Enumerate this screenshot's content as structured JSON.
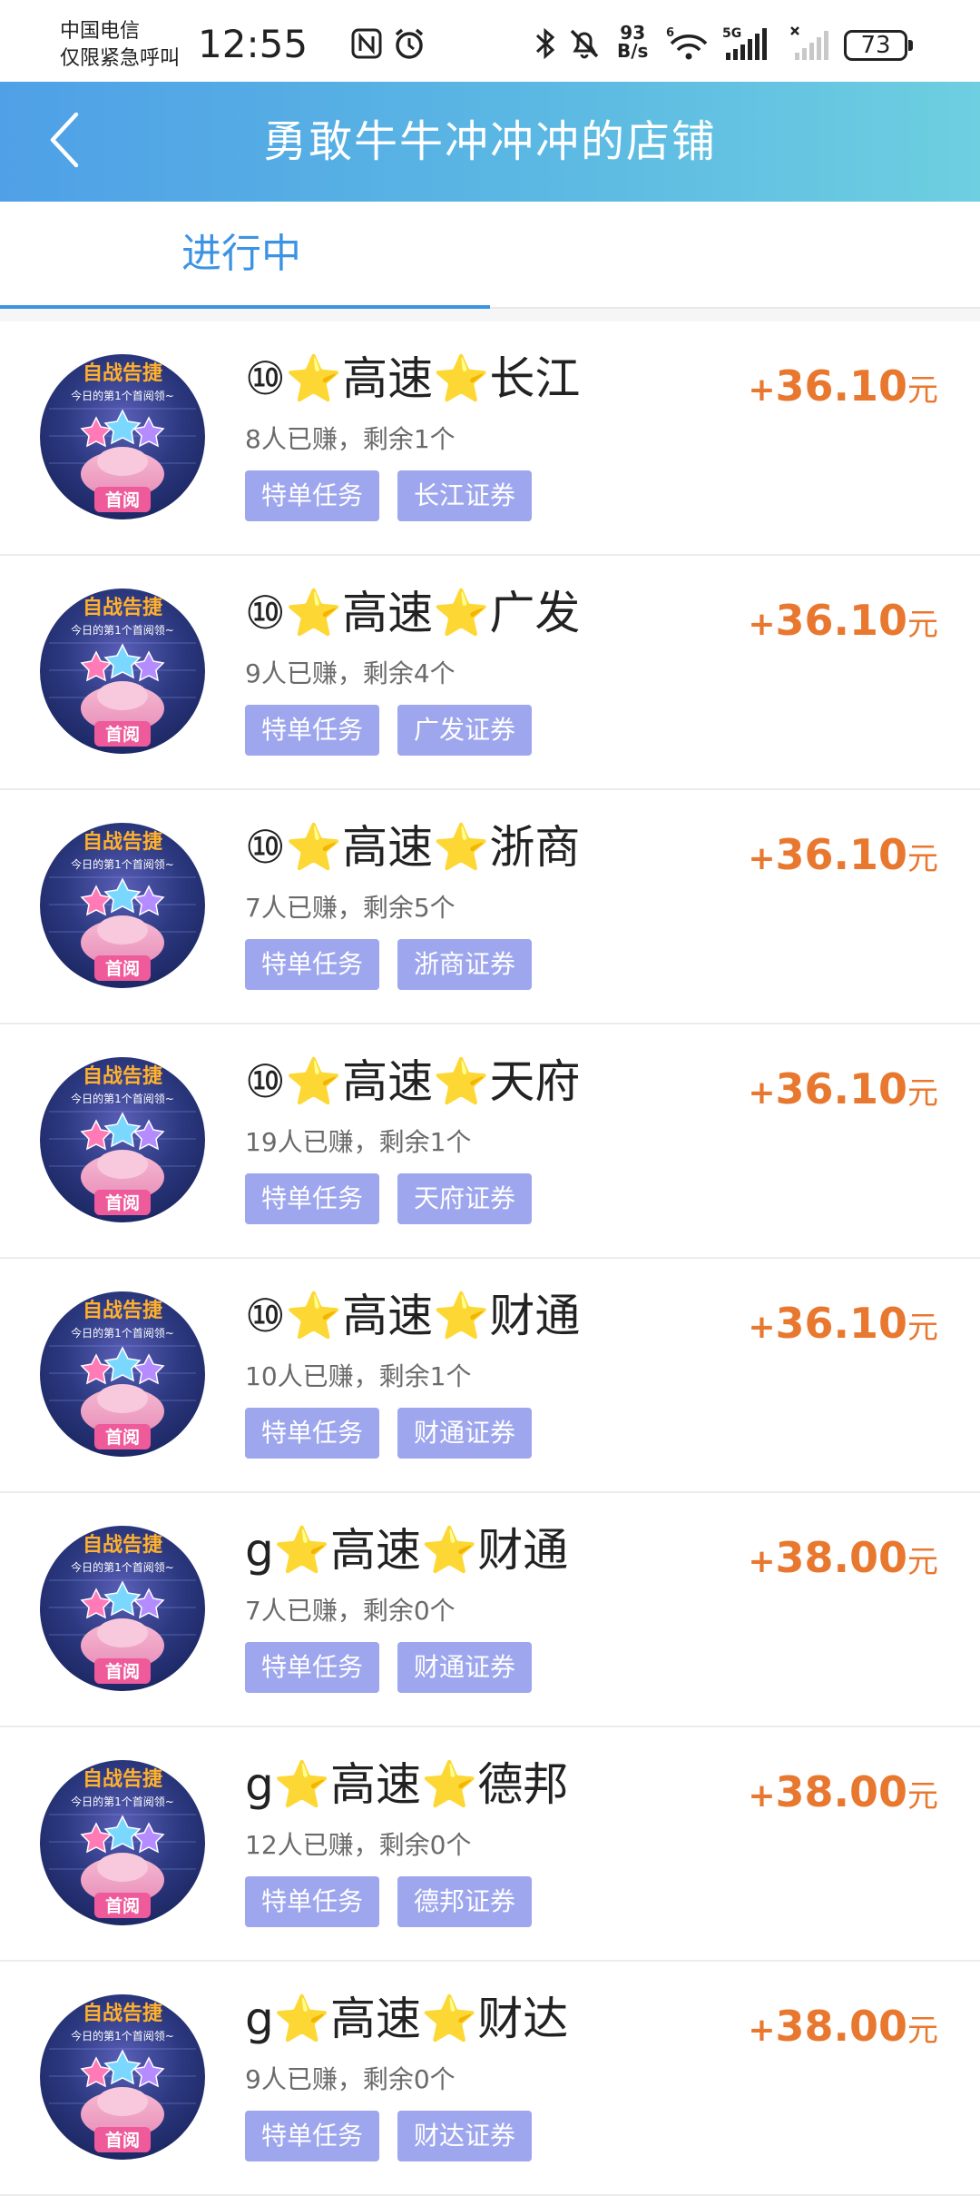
{
  "status_bar": {
    "carrier_line1": "中国电信",
    "carrier_line2": "仅限紧急呼叫",
    "time": "12:55",
    "net_speed_value": "93",
    "net_speed_unit": "B/s",
    "battery": "73",
    "icons": [
      "nfc-icon",
      "alarm-icon",
      "bluetooth-icon",
      "mute-icon",
      "wifi-icon",
      "signal-5g-icon",
      "signal-none-icon"
    ]
  },
  "header": {
    "title": "勇敢牛牛冲冲冲的店铺",
    "back_icon": "chevron-left-icon"
  },
  "tabs": [
    {
      "label": "进行中",
      "active": true
    }
  ],
  "colors": {
    "header_start": "#4fa0e6",
    "header_end": "#6dcfe0",
    "tab_active": "#3d93e3",
    "reward": "#e8782f",
    "tag_bg": "#9ea6ee"
  },
  "items": [
    {
      "title": "⑩⭐高速⭐长江",
      "stat": "8人已赚，剩余1个",
      "tag1": "特单任务",
      "tag2": "长江证券",
      "reward_sign": "+",
      "reward": "36.10",
      "reward_unit": "元"
    },
    {
      "title": "⑩⭐高速⭐广发",
      "stat": "9人已赚，剩余4个",
      "tag1": "特单任务",
      "tag2": "广发证券",
      "reward_sign": "+",
      "reward": "36.10",
      "reward_unit": "元"
    },
    {
      "title": "⑩⭐高速⭐浙商",
      "stat": "7人已赚，剩余5个",
      "tag1": "特单任务",
      "tag2": "浙商证券",
      "reward_sign": "+",
      "reward": "36.10",
      "reward_unit": "元"
    },
    {
      "title": "⑩⭐高速⭐天府",
      "stat": "19人已赚，剩余1个",
      "tag1": "特单任务",
      "tag2": "天府证券",
      "reward_sign": "+",
      "reward": "36.10",
      "reward_unit": "元"
    },
    {
      "title": "⑩⭐高速⭐财通",
      "stat": "10人已赚，剩余1个",
      "tag1": "特单任务",
      "tag2": "财通证券",
      "reward_sign": "+",
      "reward": "36.10",
      "reward_unit": "元"
    },
    {
      "title": "g⭐高速⭐财通",
      "stat": "7人已赚，剩余0个",
      "tag1": "特单任务",
      "tag2": "财通证券",
      "reward_sign": "+",
      "reward": "38.00",
      "reward_unit": "元"
    },
    {
      "title": "g⭐高速⭐德邦",
      "stat": "12人已赚，剩余0个",
      "tag1": "特单任务",
      "tag2": "德邦证券",
      "reward_sign": "+",
      "reward": "38.00",
      "reward_unit": "元"
    },
    {
      "title": "g⭐高速⭐财达",
      "stat": "9人已赚，剩余0个",
      "tag1": "特单任务",
      "tag2": "财达证券",
      "reward_sign": "+",
      "reward": "38.00",
      "reward_unit": "元"
    }
  ],
  "thumbnail": {
    "banner_text": "自战告捷",
    "subtitle_text": "今日的第1个首阅领~",
    "badge_text": "首阅"
  }
}
